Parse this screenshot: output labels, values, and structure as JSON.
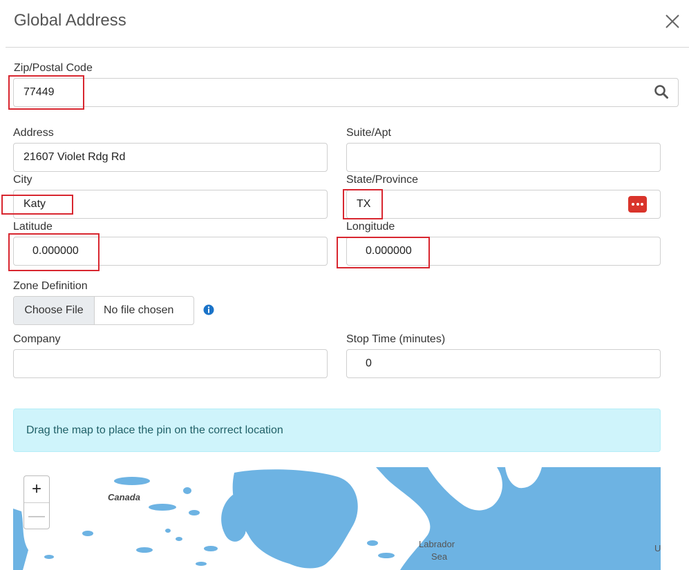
{
  "dialog": {
    "title": "Global Address"
  },
  "icons": {
    "close": "close-icon",
    "search": "search-icon",
    "dots": "more-dots-icon",
    "info": "info-icon"
  },
  "colors": {
    "accent_red": "#d9342b",
    "alert_bg": "#cff4fb",
    "map_water": "#6db3e3",
    "info_blue": "#1a73c8"
  },
  "form": {
    "zip": {
      "label": "Zip/Postal Code",
      "value": "77449"
    },
    "address": {
      "label": "Address",
      "value": "21607 Violet Rdg Rd"
    },
    "suite": {
      "label": "Suite/Apt",
      "value": ""
    },
    "city": {
      "label": "City",
      "value": "Katy"
    },
    "state": {
      "label": "State/Province",
      "value": "TX"
    },
    "latitude": {
      "label": "Latitude",
      "value": "0.000000"
    },
    "longitude": {
      "label": "Longitude",
      "value": "0.000000"
    },
    "zone": {
      "label": "Zone Definition",
      "button": "Choose File",
      "status": "No file chosen"
    },
    "company": {
      "label": "Company",
      "value": ""
    },
    "stop_time": {
      "label": "Stop Time (minutes)",
      "value": "0"
    }
  },
  "alert": {
    "text": "Drag the map to place the pin on the correct location"
  },
  "map": {
    "zoom_in": "+",
    "zoom_out": "—",
    "labels": {
      "canada": "Canada",
      "labrador_1": "Labrador",
      "labrador_2": "Sea",
      "edge": "U"
    }
  }
}
